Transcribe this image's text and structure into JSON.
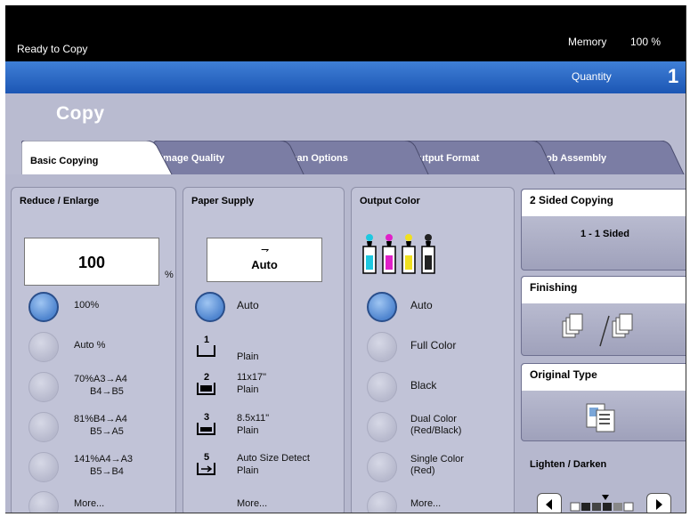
{
  "status": {
    "message": "Ready to Copy",
    "memory_label": "Memory",
    "memory_value": "100 %"
  },
  "quantity": {
    "label": "Quantity",
    "value": "1"
  },
  "page_title": "Copy",
  "tabs": [
    {
      "label": "Basic Copying",
      "active": true
    },
    {
      "label": "Image Quality",
      "active": false
    },
    {
      "label": "Scan Options",
      "active": false
    },
    {
      "label": "Output Format",
      "active": false
    },
    {
      "label": "Job Assembly",
      "active": false
    }
  ],
  "reduce_enlarge": {
    "title": "Reduce / Enlarge",
    "value": "100",
    "unit": "%",
    "options": [
      {
        "line1": "100%",
        "line2": "",
        "selected": true
      },
      {
        "line1": "Auto %",
        "line2": "",
        "selected": false
      },
      {
        "line1": "70%A3→A4",
        "line2": "B4→B5",
        "selected": false
      },
      {
        "line1": "81%B4→A4",
        "line2": "B5→A5",
        "selected": false
      },
      {
        "line1": "141%A4→A3",
        "line2": "B5→B4",
        "selected": false
      },
      {
        "line1": "More...",
        "line2": "",
        "selected": false
      }
    ]
  },
  "paper_supply": {
    "title": "Paper Supply",
    "value": "Auto",
    "auto_label": "Auto",
    "trays": [
      {
        "number": "1",
        "size": "",
        "type": "Plain"
      },
      {
        "number": "2",
        "size": "11x17\"",
        "type": "Plain"
      },
      {
        "number": "3",
        "size": "8.5x11\"",
        "type": "Plain"
      },
      {
        "number": "5",
        "size": "Auto Size Detect",
        "type": "Plain"
      }
    ],
    "more_label": "More..."
  },
  "output_color": {
    "title": "Output Color",
    "options": [
      {
        "label": "Auto",
        "selected": true
      },
      {
        "label": "Full Color",
        "selected": false
      },
      {
        "label": "Black",
        "selected": false
      },
      {
        "label": "Dual Color\n(Red/Black)",
        "selected": false
      },
      {
        "label": "Single Color\n(Red)",
        "selected": false
      },
      {
        "label": "More...",
        "selected": false
      }
    ],
    "toner_colors": [
      "#1ec8e0",
      "#e020c8",
      "#f0e020",
      "#222222"
    ]
  },
  "side": {
    "two_sided": {
      "title": "2 Sided Copying",
      "value": "1 - 1 Sided"
    },
    "finishing": {
      "title": "Finishing"
    },
    "original_type": {
      "title": "Original Type"
    },
    "lighten_darken": {
      "title": "Lighten / Darken"
    }
  },
  "colors": {
    "blue_bar": "#2a66c8",
    "panel": "#c1c3d7",
    "radio_selected": "#4f85cf"
  }
}
